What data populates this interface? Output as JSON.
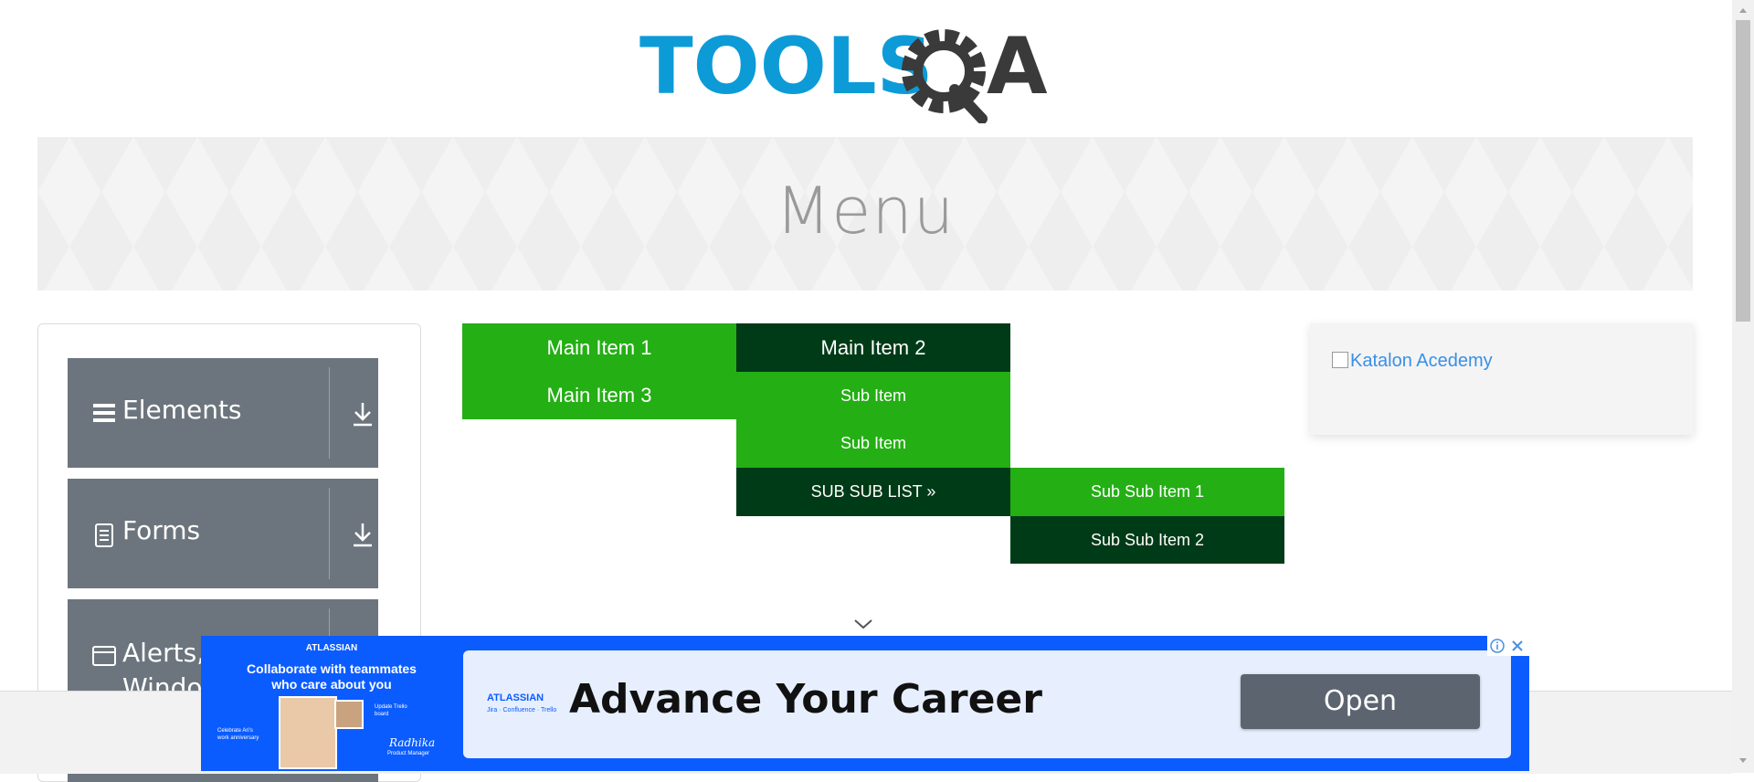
{
  "logo": {
    "text_tools": "TOOLS",
    "text_a": "A",
    "colors": {
      "tools": "#0d9bd7",
      "qa": "#3a3a3a"
    }
  },
  "banner": {
    "title": "Menu"
  },
  "sidebar": {
    "groups": [
      {
        "label": "Elements",
        "icon": "hamburger-icon"
      },
      {
        "label": "Forms",
        "icon": "document-icon"
      },
      {
        "label": "Alerts, Frame & Windows",
        "icon": "window-icon"
      }
    ]
  },
  "menu": {
    "main_item_1": "Main Item 1",
    "main_item_2": "Main Item 2",
    "main_item_3": "Main Item 3",
    "sub_item_1": "Sub Item",
    "sub_item_2": "Sub Item",
    "sub_sub_list": "SUB SUB LIST »",
    "sub_sub_item_1": "Sub Sub Item 1",
    "sub_sub_item_2": "Sub Sub Item 2",
    "colors": {
      "light": "#24af15",
      "dark": "#003b17"
    }
  },
  "side_ad": {
    "alt": "Katalon Acedemy"
  },
  "bottom_ad": {
    "brand": "ATLASSIAN",
    "brand_products": "Jira · Confluence · Trello",
    "left_headline": "Collaborate with teammates who care about you",
    "note_1": "Update Trello board",
    "note_2": "Celebrate Ari's work anniversary",
    "signature": "Radhika",
    "signature_role": "Product Manager",
    "headline": "Advance Your Career",
    "button": "Open",
    "colors": {
      "background": "#0b5cff",
      "panel": "#e7efff",
      "button": "#5c6470"
    }
  }
}
